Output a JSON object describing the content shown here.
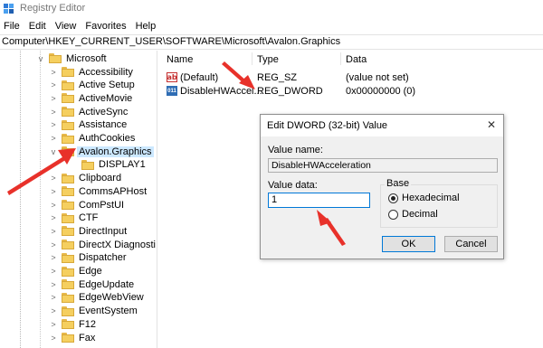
{
  "window": {
    "title": "Registry Editor"
  },
  "menu": [
    "File",
    "Edit",
    "View",
    "Favorites",
    "Help"
  ],
  "address": "Computer\\HKEY_CURRENT_USER\\SOFTWARE\\Microsoft\\Avalon.Graphics",
  "tree": {
    "root": "Microsoft",
    "items": [
      {
        "label": "Accessibility",
        "chevron": ">"
      },
      {
        "label": "Active Setup",
        "chevron": ">"
      },
      {
        "label": "ActiveMovie",
        "chevron": ">"
      },
      {
        "label": "ActiveSync",
        "chevron": ">"
      },
      {
        "label": "Assistance",
        "chevron": ">"
      },
      {
        "label": "AuthCookies",
        "chevron": ">"
      },
      {
        "label": "Avalon.Graphics",
        "chevron": "v",
        "selected": true
      },
      {
        "label": "DISPLAY1",
        "chevron": "",
        "child": true
      },
      {
        "label": "Clipboard",
        "chevron": ">"
      },
      {
        "label": "CommsAPHost",
        "chevron": ">"
      },
      {
        "label": "ComPstUI",
        "chevron": ">"
      },
      {
        "label": "CTF",
        "chevron": ">"
      },
      {
        "label": "DirectInput",
        "chevron": ">"
      },
      {
        "label": "DirectX Diagnosti",
        "chevron": ">"
      },
      {
        "label": "Dispatcher",
        "chevron": ">"
      },
      {
        "label": "Edge",
        "chevron": ">"
      },
      {
        "label": "EdgeUpdate",
        "chevron": ">"
      },
      {
        "label": "EdgeWebView",
        "chevron": ">"
      },
      {
        "label": "EventSystem",
        "chevron": ">"
      },
      {
        "label": "F12",
        "chevron": ">"
      },
      {
        "label": "Fax",
        "chevron": ">"
      }
    ]
  },
  "list": {
    "columns": {
      "name": "Name",
      "type": "Type",
      "data": "Data"
    },
    "rows": [
      {
        "icon": "string-value-icon",
        "name": "(Default)",
        "type": "REG_SZ",
        "data": "(value not set)"
      },
      {
        "icon": "binary-value-icon",
        "name": "DisableHWAccel...",
        "type": "REG_DWORD",
        "data": "0x00000000 (0)"
      }
    ]
  },
  "dialog": {
    "title": "Edit DWORD (32-bit) Value",
    "close": "✕",
    "value_name_label": "Value name:",
    "value_name": "DisableHWAcceleration",
    "value_data_label": "Value data:",
    "value_data": "1",
    "base_label": "Base",
    "hex_label": "Hexadecimal",
    "dec_label": "Decimal",
    "hex_selected": true,
    "ok": "OK",
    "cancel": "Cancel"
  },
  "colors": {
    "arrow": "#e8312a",
    "selection": "#cce8ff",
    "focus_border": "#0078d7"
  }
}
